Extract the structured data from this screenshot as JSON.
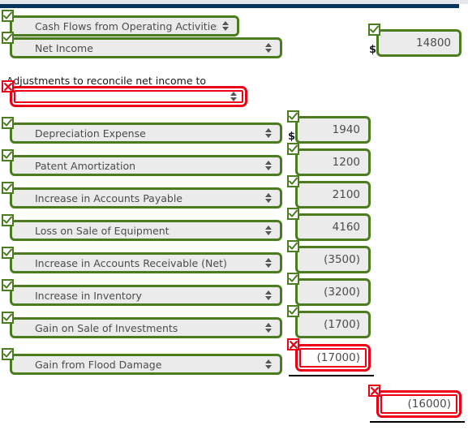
{
  "theme": {
    "top_bar_color": "#06335c",
    "top_strip_color": "#e4e8ed",
    "valid_color": "#4b7d20",
    "error_color": "#ec0016",
    "field_fill": "#ebebeb",
    "text_color": "#4c4c4c"
  },
  "caption": {
    "adjustments": "Adjustments to reconcile net income to"
  },
  "currency_symbol": "$",
  "section": {
    "select_value": "Cash Flows from Operating Activities",
    "status": "valid"
  },
  "rows": [
    {
      "label": "Net Income",
      "label_status": "valid",
      "amount": "14800",
      "amount_status": "valid",
      "show_currency": true
    },
    {
      "label": "",
      "label_status": "error",
      "amount": null,
      "amount_status": null,
      "show_currency": false
    },
    {
      "label": "Depreciation Expense",
      "label_status": "valid",
      "amount": "1940",
      "amount_status": "valid",
      "show_currency": true
    },
    {
      "label": "Patent Amortization",
      "label_status": "valid",
      "amount": "1200",
      "amount_status": "valid",
      "show_currency": false
    },
    {
      "label": "Increase in Accounts Payable",
      "label_status": "valid",
      "amount": "2100",
      "amount_status": "valid",
      "show_currency": false
    },
    {
      "label": "Loss on Sale of Equipment",
      "label_status": "valid",
      "amount": "4160",
      "amount_status": "valid",
      "show_currency": false
    },
    {
      "label": "Increase in Accounts Receivable (Net)",
      "label_status": "valid",
      "amount": "(3500)",
      "amount_status": "valid",
      "show_currency": false
    },
    {
      "label": "Increase in Inventory",
      "label_status": "valid",
      "amount": "(3200)",
      "amount_status": "valid",
      "show_currency": false
    },
    {
      "label": "Gain on Sale of Investments",
      "label_status": "valid",
      "amount": "(1700)",
      "amount_status": "valid",
      "show_currency": false
    },
    {
      "label": "Gain from Flood Damage",
      "label_status": "valid",
      "amount": "(17000)",
      "amount_status": "error",
      "show_currency": false
    }
  ],
  "total": {
    "amount": "(16000)",
    "amount_status": "error"
  },
  "icons": {
    "valid_badge": "check-icon",
    "error_badge": "x-icon",
    "select_arrows": "spinner-arrows-icon"
  }
}
